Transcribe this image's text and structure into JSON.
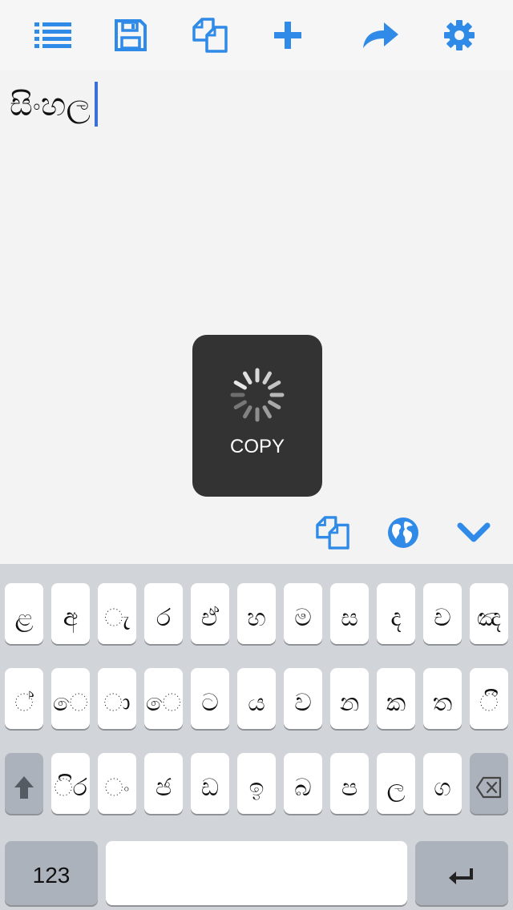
{
  "editor": {
    "text": "සිංහල"
  },
  "hud": {
    "label": "COPY"
  },
  "colors": {
    "accent": "#2f8ae8",
    "hud_bg": "#333333",
    "keyboard_bg": "#d1d4d9"
  },
  "toolbar": {
    "icons": [
      "list-icon",
      "save-icon",
      "copy-icon",
      "plus-icon",
      "share-icon",
      "gear-icon"
    ]
  },
  "accessory": {
    "icons": [
      "copy-icon",
      "globe-icon",
      "chevron-down-icon"
    ]
  },
  "keyboard": {
    "row1": [
      "ළ",
      "අ",
      "ැ",
      "ර",
      "ඒ",
      "හ",
      "ම",
      "ස",
      "ද",
      "ච",
      "ඤ"
    ],
    "row2": [
      "්",
      "ෙ",
      "ා",
      "ෙ",
      "ට",
      "ය",
      "ව",
      "න",
      "ක",
      "ත",
      "ී"
    ],
    "row3": [
      "ිර",
      "ං",
      "ජ",
      "ඩ",
      "ඉ",
      "බ",
      "ප",
      "ල",
      "ග"
    ],
    "numbers_label": "123"
  }
}
